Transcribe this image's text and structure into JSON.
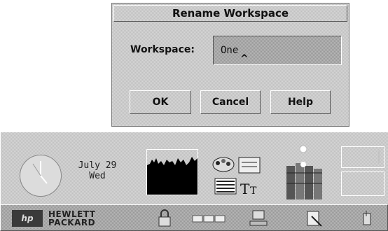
{
  "dialog": {
    "title": "Rename Workspace",
    "field_label": "Workspace:",
    "field_value": "One",
    "caret": "^",
    "buttons": {
      "ok": "OK",
      "cancel": "Cancel",
      "help": "Help"
    }
  },
  "front_panel": {
    "date_line1": "July 29",
    "date_line2": "Wed",
    "icons": [
      "clock-icon",
      "calendar-date",
      "performance-meter-icon",
      "applications-icon",
      "mail-icon",
      "trash-icon"
    ]
  },
  "taskbar": {
    "logo_mark": "hp",
    "logo_line1": "HEWLETT",
    "logo_line2": "PACKARD",
    "icons": [
      "lock-icon",
      "workspace-switch-icon",
      "terminal-icon",
      "edit-icon",
      "help-icon"
    ]
  }
}
